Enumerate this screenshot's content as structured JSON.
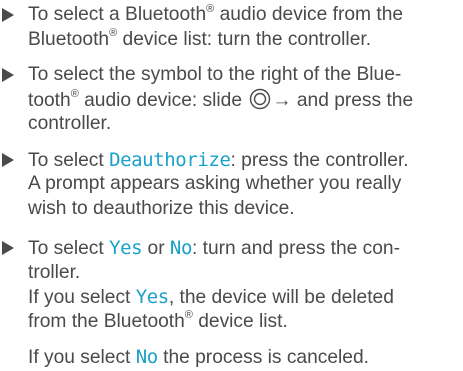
{
  "steps": {
    "step1": {
      "line1": "To select a Bluetooth",
      "line1_reg": "®",
      "line1_rest": " audio device from the",
      "line2": "Bluetooth",
      "line2_reg": "®",
      "line2_rest": " device list: turn the controller."
    },
    "step2": {
      "line1": "To select the symbol to the right of the Blue-",
      "line2": "tooth",
      "line2_reg": "®",
      "line2_mid": " audio device: slide ",
      "line2_arrow": "→",
      "line2_rest": " and press the",
      "line3": "controller."
    },
    "step3": {
      "pre": "To select ",
      "keyword": "Deauthorize",
      "post": ": press the controller.",
      "line2": "A prompt appears asking whether you really",
      "line3": "wish to deauthorize this device."
    },
    "step4": {
      "pre": "To select ",
      "keyword_yes": "Yes",
      "or": " or ",
      "keyword_no": "No",
      "post": ": turn and press the con-",
      "line2": "troller.",
      "line3_pre": "If you select ",
      "line3_yes": "Yes",
      "line3_post": ", the device will be deleted",
      "line4_pre": "from the Bluetooth",
      "line4_reg": "®",
      "line4_post": " device list.",
      "line5_pre": "If you select ",
      "line5_no": "No",
      "line5_post": " the process is canceled."
    }
  },
  "icons": {
    "bullet": "triangle-right-icon",
    "controller": "controller-dial-icon"
  },
  "colors": {
    "text": "#4a4a4a",
    "keyword": "#1aa1c9"
  }
}
